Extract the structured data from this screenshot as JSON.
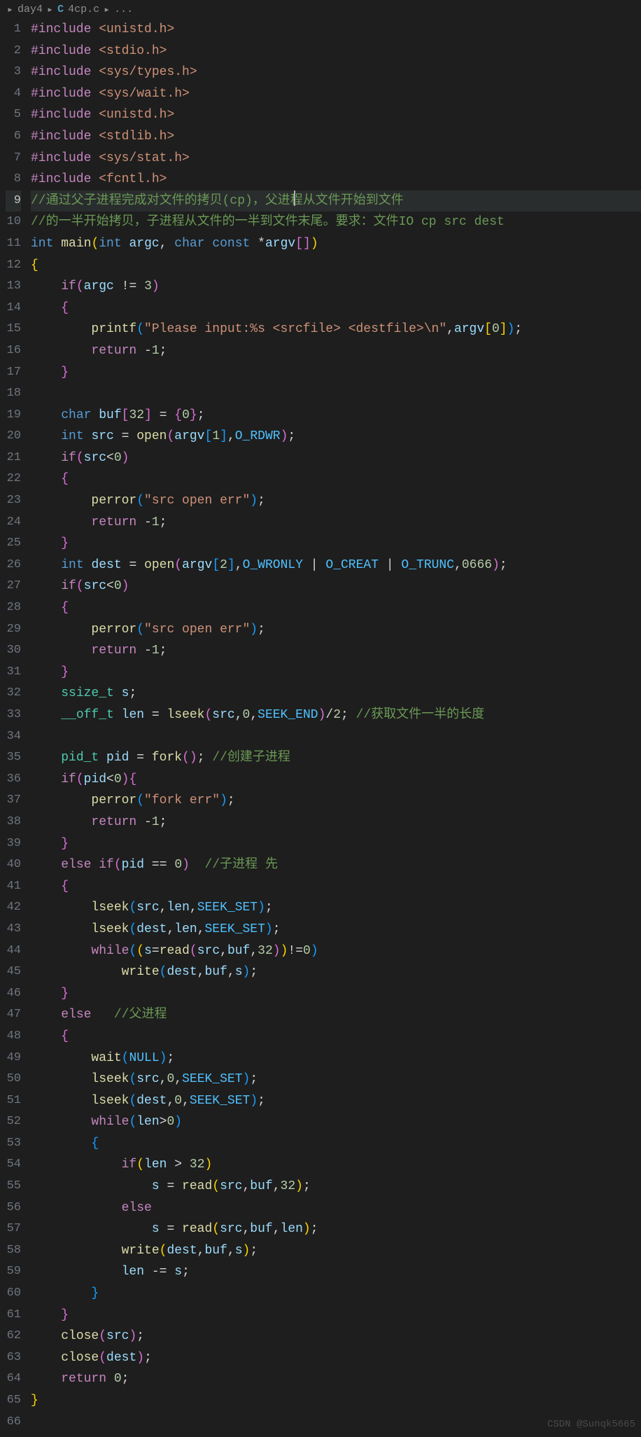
{
  "breadcrumb": {
    "folder": "day4",
    "file": "4cp.c",
    "more": "..."
  },
  "watermark": "CSDN @Sunqk5665",
  "lines": [
    {
      "n": 1
    },
    {
      "n": 2
    },
    {
      "n": 3
    },
    {
      "n": 4
    },
    {
      "n": 5
    },
    {
      "n": 6
    },
    {
      "n": 7
    },
    {
      "n": 8
    },
    {
      "n": 9,
      "active": true
    },
    {
      "n": 10
    },
    {
      "n": 11
    },
    {
      "n": 12
    },
    {
      "n": 13
    },
    {
      "n": 14
    },
    {
      "n": 15
    },
    {
      "n": 16
    },
    {
      "n": 17
    },
    {
      "n": 18
    },
    {
      "n": 19
    },
    {
      "n": 20
    },
    {
      "n": 21
    },
    {
      "n": 22
    },
    {
      "n": 23
    },
    {
      "n": 24
    },
    {
      "n": 25
    },
    {
      "n": 26
    },
    {
      "n": 27
    },
    {
      "n": 28
    },
    {
      "n": 29
    },
    {
      "n": 30
    },
    {
      "n": 31
    },
    {
      "n": 32
    },
    {
      "n": 33
    },
    {
      "n": 34
    },
    {
      "n": 35
    },
    {
      "n": 36
    },
    {
      "n": 37
    },
    {
      "n": 38
    },
    {
      "n": 39
    },
    {
      "n": 40
    },
    {
      "n": 41
    },
    {
      "n": 42
    },
    {
      "n": 43
    },
    {
      "n": 44
    },
    {
      "n": 45
    },
    {
      "n": 46
    },
    {
      "n": 47
    },
    {
      "n": 48
    },
    {
      "n": 49
    },
    {
      "n": 50
    },
    {
      "n": 51
    },
    {
      "n": 52
    },
    {
      "n": 53
    },
    {
      "n": 54
    },
    {
      "n": 55
    },
    {
      "n": 56
    },
    {
      "n": 57
    },
    {
      "n": 58
    },
    {
      "n": 59
    },
    {
      "n": 60
    },
    {
      "n": 61
    },
    {
      "n": 62
    },
    {
      "n": 63
    },
    {
      "n": 64
    },
    {
      "n": 65
    },
    {
      "n": 66
    }
  ],
  "code": {
    "l1": {
      "pp": "#include",
      "str": "<unistd.h>"
    },
    "l2": {
      "pp": "#include",
      "str": "<stdio.h>"
    },
    "l3": {
      "pp": "#include",
      "str": "<sys/types.h>"
    },
    "l4": {
      "pp": "#include",
      "str": "<sys/wait.h>"
    },
    "l5": {
      "pp": "#include",
      "str": "<unistd.h>"
    },
    "l6": {
      "pp": "#include",
      "str": "<stdlib.h>"
    },
    "l7": {
      "pp": "#include",
      "str": "<sys/stat.h>"
    },
    "l8": {
      "pp": "#include",
      "str": "<fcntl.h>"
    },
    "l9": {
      "comment": "//通过父子进程完成对文件的拷贝(cp)，父进程从文件开始到文件"
    },
    "l10": {
      "comment": "//的一半开始拷贝，子进程从文件的一半到文件末尾。要求：文件IO cp src dest"
    },
    "l11": {
      "kw_int": "int",
      "fn": "main",
      "kw_int2": "int",
      "arg1": "argc",
      "kw_char": "char",
      "kw_const": "const",
      "op": "*",
      "arg2": "argv"
    },
    "l12": {
      "brace": "{"
    },
    "l13": {
      "kw": "if",
      "var": "argc",
      "op": "!=",
      "num": "3"
    },
    "l14": {
      "brace": "{"
    },
    "l15": {
      "fn": "printf",
      "str": "\"Please input:%s <srcfile> <destfile>\\n\"",
      "var": "argv",
      "num": "0"
    },
    "l16": {
      "kw": "return",
      "op": "-",
      "num": "1"
    },
    "l17": {
      "brace": "}"
    },
    "l18": {},
    "l19": {
      "kw": "char",
      "var": "buf",
      "num1": "32",
      "num2": "0"
    },
    "l20": {
      "kw": "int",
      "var": "src",
      "fn": "open",
      "arg": "argv",
      "num": "1",
      "const": "O_RDWR"
    },
    "l21": {
      "kw": "if",
      "var": "src",
      "op": "<",
      "num": "0"
    },
    "l22": {
      "brace": "{"
    },
    "l23": {
      "fn": "perror",
      "str": "\"src open err\""
    },
    "l24": {
      "kw": "return",
      "op": "-",
      "num": "1"
    },
    "l25": {
      "brace": "}"
    },
    "l26": {
      "kw": "int",
      "var": "dest",
      "fn": "open",
      "arg": "argv",
      "num": "2",
      "c1": "O_WRONLY",
      "c2": "O_CREAT",
      "c3": "O_TRUNC",
      "mode": "0666"
    },
    "l27": {
      "kw": "if",
      "var": "src",
      "op": "<",
      "num": "0"
    },
    "l28": {
      "brace": "{"
    },
    "l29": {
      "fn": "perror",
      "str": "\"src open err\""
    },
    "l30": {
      "kw": "return",
      "op": "-",
      "num": "1"
    },
    "l31": {
      "brace": "}"
    },
    "l32": {
      "type": "ssize_t",
      "var": "s"
    },
    "l33": {
      "type": "__off_t",
      "var": "len",
      "fn": "lseek",
      "arg": "src",
      "num1": "0",
      "const": "SEEK_END",
      "num2": "2",
      "comment": "//获取文件一半的长度"
    },
    "l34": {},
    "l35": {
      "type": "pid_t",
      "var": "pid",
      "fn": "fork",
      "comment": "//创建子进程"
    },
    "l36": {
      "kw": "if",
      "var": "pid",
      "op": "<",
      "num": "0"
    },
    "l37": {
      "fn": "perror",
      "str": "\"fork err\""
    },
    "l38": {
      "kw": "return",
      "op": "-",
      "num": "1"
    },
    "l39": {
      "brace": "}"
    },
    "l40": {
      "kw1": "else",
      "kw2": "if",
      "var": "pid",
      "op": "==",
      "num": "0",
      "comment": "//子进程 先"
    },
    "l41": {
      "brace": "{"
    },
    "l42": {
      "fn": "lseek",
      "a1": "src",
      "a2": "len",
      "const": "SEEK_SET"
    },
    "l43": {
      "fn": "lseek",
      "a1": "dest",
      "a2": "len",
      "const": "SEEK_SET"
    },
    "l44": {
      "kw": "while",
      "var": "s",
      "fn": "read",
      "a1": "src",
      "a2": "buf",
      "num1": "32",
      "num2": "0"
    },
    "l45": {
      "fn": "write",
      "a1": "dest",
      "a2": "buf",
      "a3": "s"
    },
    "l46": {
      "brace": "}"
    },
    "l47": {
      "kw": "else",
      "comment": "//父进程"
    },
    "l48": {
      "brace": "{"
    },
    "l49": {
      "fn": "wait",
      "const": "NULL"
    },
    "l50": {
      "fn": "lseek",
      "a1": "src",
      "num": "0",
      "const": "SEEK_SET"
    },
    "l51": {
      "fn": "lseek",
      "a1": "dest",
      "num": "0",
      "const": "SEEK_SET"
    },
    "l52": {
      "kw": "while",
      "var": "len",
      "op": ">",
      "num": "0"
    },
    "l53": {
      "brace": "{"
    },
    "l54": {
      "kw": "if",
      "var": "len",
      "op": ">",
      "num": "32"
    },
    "l55": {
      "var": "s",
      "fn": "read",
      "a1": "src",
      "a2": "buf",
      "num": "32"
    },
    "l56": {
      "kw": "else"
    },
    "l57": {
      "var": "s",
      "fn": "read",
      "a1": "src",
      "a2": "buf",
      "a3": "len"
    },
    "l58": {
      "fn": "write",
      "a1": "dest",
      "a2": "buf",
      "a3": "s"
    },
    "l59": {
      "var1": "len",
      "op": "-=",
      "var2": "s"
    },
    "l60": {
      "brace": "}"
    },
    "l61": {
      "brace": "}"
    },
    "l62": {
      "fn": "close",
      "var": "src"
    },
    "l63": {
      "fn": "close",
      "var": "dest"
    },
    "l64": {
      "kw": "return",
      "num": "0"
    },
    "l65": {
      "brace": "}"
    },
    "l66": {}
  }
}
